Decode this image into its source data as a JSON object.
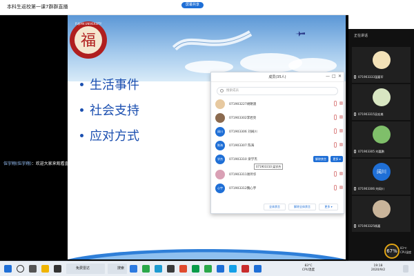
{
  "window": {
    "title": "本科生返校第一课7群群直播",
    "recording_pill": "屏幕共享",
    "controls": [
      "—",
      "□",
      "✕"
    ]
  },
  "slide": {
    "bullets": [
      "生活事件",
      "社会支持",
      "应对方式"
    ],
    "logo_char": "福",
    "logo_ring_text": "FUJIAN UNIVERSITY"
  },
  "chat": {
    "sender": "伍宇翔(伍宇翔)",
    "message": "：欢迎大家来观看直播 \"2020年本科生返校第一课\"。"
  },
  "members": {
    "title": "成员(35人)",
    "search_placeholder": "搜索成员",
    "rows": [
      {
        "name": "071903227胡朝澳",
        "avatar": "img",
        "avatar_color": "#e7c9a0"
      },
      {
        "name": "071903302李岩亮",
        "avatar": "img",
        "avatar_color": "#8b6a4f"
      },
      {
        "name": "071903306 刘阔川",
        "avatar": "阔川",
        "avatar_color": "#1f6fd6"
      },
      {
        "name": "071903307 陈海",
        "avatar": "陈海",
        "avatar_color": "#1f6fd6"
      },
      {
        "name": "071903310 梁学杰",
        "avatar": "学杰",
        "avatar_color": "#1f6fd6"
      },
      {
        "name": "071903311谢玲华",
        "avatar": "img",
        "avatar_color": "#d9a0b5"
      },
      {
        "name": "071903312魏心宇",
        "avatar": "心宇",
        "avatar_color": "#1f6fd6"
      }
    ],
    "row_buttons": {
      "unmute": "解除禁言",
      "more": "更多 ▾"
    },
    "tooltip": "071903310 梁学杰",
    "footer": {
      "mute_all": "全体禁言",
      "unmute_all": "解除全体禁言",
      "more": "更多 ▾"
    }
  },
  "video_panel": {
    "label": "正在讲话",
    "tiles": [
      {
        "name": "071903333温嘉军",
        "kind": "img",
        "color": "#f3e2b8"
      },
      {
        "name": "071903315吴宏美",
        "kind": "img",
        "color": "#d8e6c2"
      },
      {
        "name": "071903305 刘嘉鹏",
        "kind": "img",
        "color": "#7fbf6a"
      },
      {
        "name": "071903306 刘阔川",
        "kind": "initial",
        "initial": "阔川"
      },
      {
        "name": "071903325杨嘉",
        "kind": "img",
        "color": "#c9b49a"
      }
    ]
  },
  "cpu": {
    "percent": "67%",
    "label_top": "83℃",
    "label_bottom": "CPU温度"
  },
  "taskbar": {
    "apps": [
      {
        "label": "免费雷达"
      },
      {
        "label": "搜索一下"
      }
    ],
    "temp": "83°C",
    "temp_label": "CPU温度",
    "time": "19:18",
    "date": "2020/9/2"
  },
  "colors": {
    "accent": "#1f6fd6",
    "slide_text": "#1b4fb0",
    "cpu_ring": "#e2a514"
  }
}
